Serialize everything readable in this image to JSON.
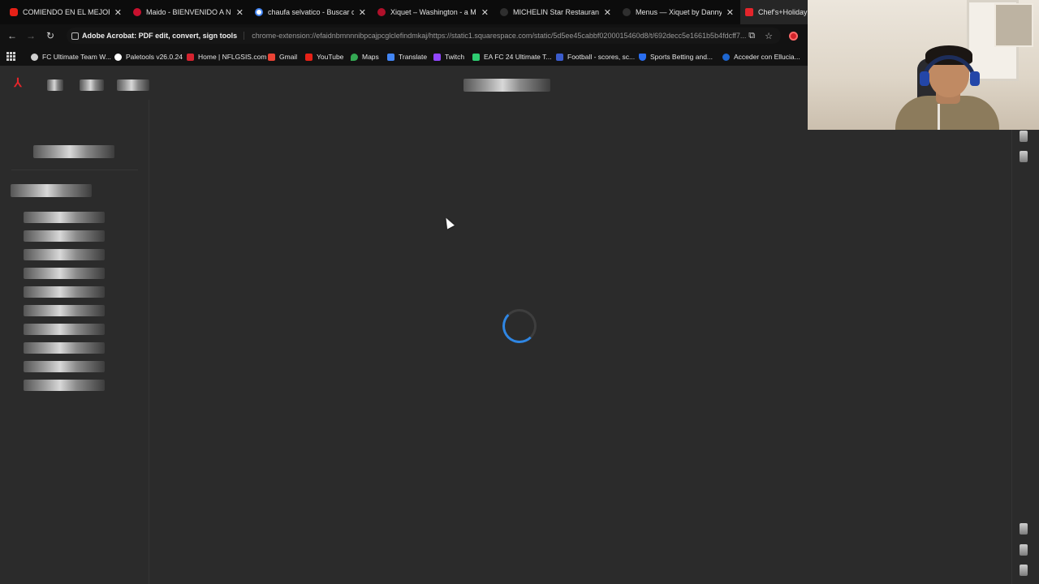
{
  "tabs": [
    {
      "title": "COMIENDO EN EL MEJOR RE",
      "icon": "youtube-icon",
      "color": "#e62117",
      "active": false
    },
    {
      "title": "Maido - BIENVENIDO A NUE",
      "icon": "maido-icon",
      "color": "#c8102e",
      "active": false
    },
    {
      "title": "chaufa selvatico - Buscar con",
      "icon": "google-icon",
      "color": "#4285f4",
      "active": false
    },
    {
      "title": "Xiquet – Washington - a MIC",
      "icon": "michelin-icon",
      "color": "#b0102a",
      "active": false
    },
    {
      "title": "MICHELIN Star Restaurant in",
      "icon": "page-icon",
      "color": "#2f2f2f",
      "active": false
    },
    {
      "title": "Menus — Xiquet by Danny L",
      "icon": "page-icon",
      "color": "#2f2f2f",
      "active": false
    },
    {
      "title": "Chef's+Holiday+M",
      "icon": "acrobat-icon",
      "color": "#e4252b",
      "active": true
    }
  ],
  "address_bar": {
    "extension_label": "Adobe Acrobat: PDF edit, convert, sign tools",
    "url": "chrome-extension://efaidnbmnnnibpcajpcglclefindmkaj/https://static1.squarespace.com/static/5d5ee45cabbf0200015460d8/t/692decc5e1661b5b4fdcff7..."
  },
  "bookmarks": [
    {
      "label": "FC Ultimate Team W...",
      "icon": "fut-icon",
      "color": "#cfcfcf"
    },
    {
      "label": "Paletools v26.0.24",
      "icon": "paletools-icon",
      "color": "#ffffff"
    },
    {
      "label": "Home | NFLGSIS.com",
      "icon": "nfl-icon",
      "color": "#d5232f"
    },
    {
      "label": "Gmail",
      "icon": "gmail-icon",
      "color": "#ea4335"
    },
    {
      "label": "YouTube",
      "icon": "youtube-icon",
      "color": "#e62117"
    },
    {
      "label": "Maps",
      "icon": "maps-icon",
      "color": "#34a853"
    },
    {
      "label": "Translate",
      "icon": "translate-icon",
      "color": "#4285f4"
    },
    {
      "label": "Twitch",
      "icon": "twitch-icon",
      "color": "#9146ff"
    },
    {
      "label": "EA FC 24 Ultimate T...",
      "icon": "easports-icon",
      "color": "#2ecc71"
    },
    {
      "label": "Football - scores, sc...",
      "icon": "football-icon",
      "color": "#3b5ccc"
    },
    {
      "label": "Sports Betting and...",
      "icon": "shield-icon",
      "color": "#2a6ef0"
    },
    {
      "label": "Acceder con Ellucia...",
      "icon": "ellucian-icon",
      "color": "#1e66d0"
    }
  ],
  "colors": {
    "accent_red": "#e4252b",
    "spinner_blue": "#2f86e3",
    "viewer_background": "#2b2b2b"
  }
}
